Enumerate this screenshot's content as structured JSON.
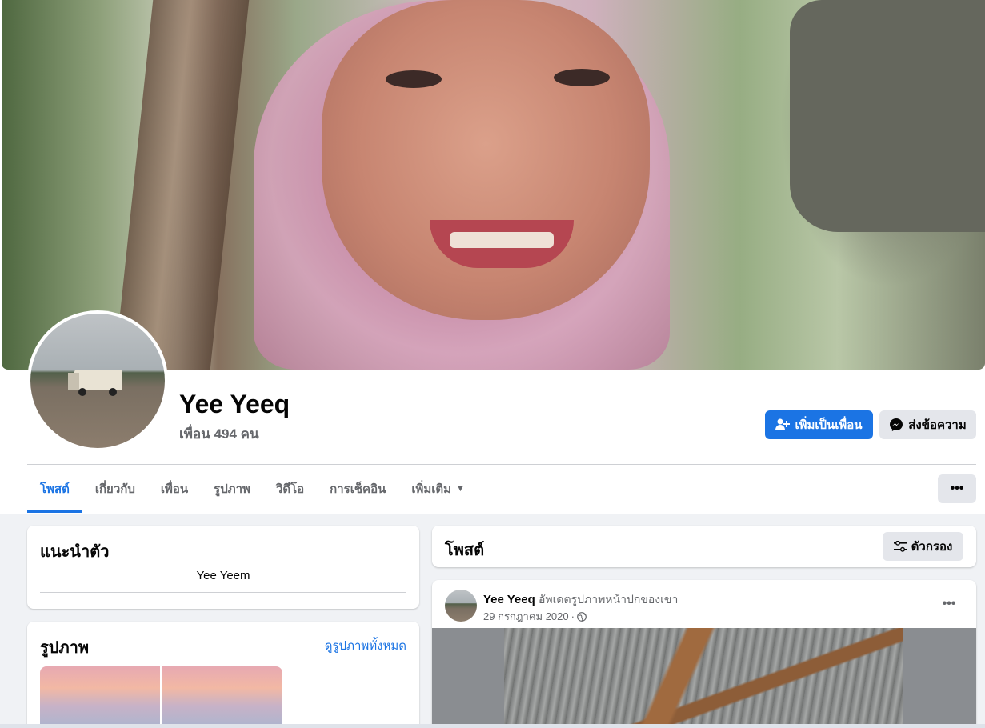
{
  "profile": {
    "name": "Yee Yeeq",
    "friends": "เพื่อน 494 คน",
    "add_friend_label": "เพิ่มเป็นเพื่อน",
    "message_label": "ส่งข้อความ"
  },
  "tabs": [
    {
      "label": "โพสต์"
    },
    {
      "label": "เกี่ยวกับ"
    },
    {
      "label": "เพื่อน"
    },
    {
      "label": "รูปภาพ"
    },
    {
      "label": "วิดีโอ"
    },
    {
      "label": "การเช็คอิน"
    },
    {
      "label": "เพิ่มเติม"
    }
  ],
  "intro": {
    "title": "แนะนำตัว",
    "bio": "Yee Yeem"
  },
  "photos": {
    "title": "รูปภาพ",
    "see_all": "ดูรูปภาพทั้งหมด"
  },
  "posts": {
    "title": "โพสต์",
    "filter_label": "ตัวกรอง"
  },
  "post": {
    "author": "Yee Yeeq",
    "action": "อัพเดตรูปภาพหน้าปกของเขา",
    "date": "29 กรกฎาคม 2020",
    "separator": "·"
  },
  "icons": {
    "more": "•••",
    "caret": "▼"
  },
  "colors": {
    "accent": "#1b74e4",
    "secondary_button": "#e4e6eb",
    "background": "#f0f2f5"
  }
}
